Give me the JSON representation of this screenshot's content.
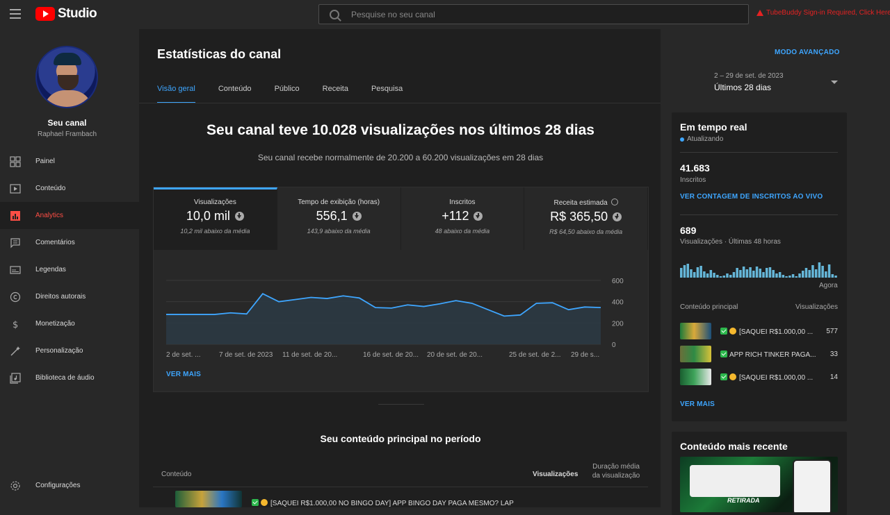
{
  "topbar": {
    "logo_text": "Studio",
    "search_placeholder": "Pesquise no seu canal",
    "tubebuddy_warning": "TubeBuddy Sign-in Required, Click Here"
  },
  "sidebar": {
    "channel_title": "Seu canal",
    "channel_owner": "Raphael Frambach",
    "items": [
      {
        "label": "Painel",
        "icon": "dashboard-icon"
      },
      {
        "label": "Conteúdo",
        "icon": "content-icon"
      },
      {
        "label": "Analytics",
        "icon": "analytics-icon"
      },
      {
        "label": "Comentários",
        "icon": "comments-icon"
      },
      {
        "label": "Legendas",
        "icon": "subtitles-icon"
      },
      {
        "label": "Direitos autorais",
        "icon": "copyright-icon"
      },
      {
        "label": "Monetização",
        "icon": "dollar-icon"
      },
      {
        "label": "Personalização",
        "icon": "magic-wand-icon"
      },
      {
        "label": "Biblioteca de áudio",
        "icon": "audio-library-icon"
      }
    ],
    "settings_label": "Configurações"
  },
  "main": {
    "title": "Estatísticas do canal",
    "tabs": [
      "Visão geral",
      "Conteúdo",
      "Público",
      "Receita",
      "Pesquisa"
    ],
    "headline": "Seu canal teve 10.028 visualizações nos últimos 28 dias",
    "subline": "Seu canal recebe normalmente de 20.200 a 60.200 visualizações em 28 dias",
    "metrics": [
      {
        "label": "Visualizações",
        "value": "10,0 mil",
        "note": "10,2 mil abaixo da média"
      },
      {
        "label": "Tempo de exibição (horas)",
        "value": "556,1",
        "note": "143,9 abaixo da média"
      },
      {
        "label": "Inscritos",
        "value": "+112",
        "note": "48 abaixo da média"
      },
      {
        "label": "Receita estimada",
        "value": "R$ 365,50",
        "note": "R$ 64,50 abaixo da média"
      }
    ],
    "see_more": "VER MAIS",
    "section_title": "Seu conteúdo principal no período",
    "table_headers": {
      "content": "Conteúdo",
      "views": "Visualizações",
      "avg_duration": "Duração média da visualização"
    },
    "first_row_title": "[SAQUEI R$1.000,00 NO BINGO DAY] APP BINGO DAY PAGA MESMO? LAP"
  },
  "chart_data": {
    "type": "area",
    "x_tick_labels": [
      "2 de set. ...",
      "7 de set. de 2023",
      "11 de set. de 20...",
      "16 de set. de 20...",
      "20 de set. de 20...",
      "25 de set. de 2...",
      "29 de s..."
    ],
    "y_tick_labels": [
      "600",
      "400",
      "200",
      "0"
    ],
    "ylim": [
      0,
      600
    ],
    "values": [
      280,
      280,
      280,
      280,
      295,
      285,
      475,
      400,
      420,
      440,
      430,
      455,
      435,
      345,
      340,
      370,
      355,
      380,
      410,
      385,
      325,
      265,
      275,
      385,
      390,
      325,
      350,
      345
    ],
    "line_color": "#3ea6ff",
    "grid": true
  },
  "right": {
    "advanced_mode": "MODO AVANÇADO",
    "date_range_dates": "2 – 29 de set. de 2023",
    "date_range_label": "Últimos 28 dias",
    "realtime": {
      "title": "Em tempo real",
      "status": "Atualizando",
      "subscribers_value": "41.683",
      "subscribers_label": "Inscritos",
      "live_count_link": "VER CONTAGEM DE INSCRITOS AO VIVO",
      "views_value": "689",
      "views_label": "Visualizações · Últimas 48 horas",
      "now_label": "Agora",
      "top_content_label": "Conteúdo principal",
      "views_col_label": "Visualizações",
      "bars": [
        14,
        18,
        20,
        12,
        8,
        15,
        17,
        9,
        6,
        11,
        7,
        4,
        2,
        3,
        6,
        4,
        8,
        14,
        11,
        16,
        12,
        15,
        10,
        16,
        13,
        8,
        14,
        15,
        11,
        6,
        8,
        4,
        2,
        3,
        5,
        2,
        6,
        10,
        14,
        11,
        18,
        12,
        22,
        17,
        9,
        19,
        5,
        3
      ],
      "items": [
        {
          "title": "[SAQUEI R$1.000,00 ...",
          "views": "577",
          "emoji": true
        },
        {
          "title": "APP RICH TINKER PAGA...",
          "views": "33",
          "emoji": false
        },
        {
          "title": "[SAQUEI R$1.000,00 ...",
          "views": "14",
          "emoji": true
        }
      ],
      "see_more": "VER MAIS"
    },
    "recent": {
      "title": "Conteúdo mais recente",
      "thumb_caption": "RETIRADA"
    }
  }
}
